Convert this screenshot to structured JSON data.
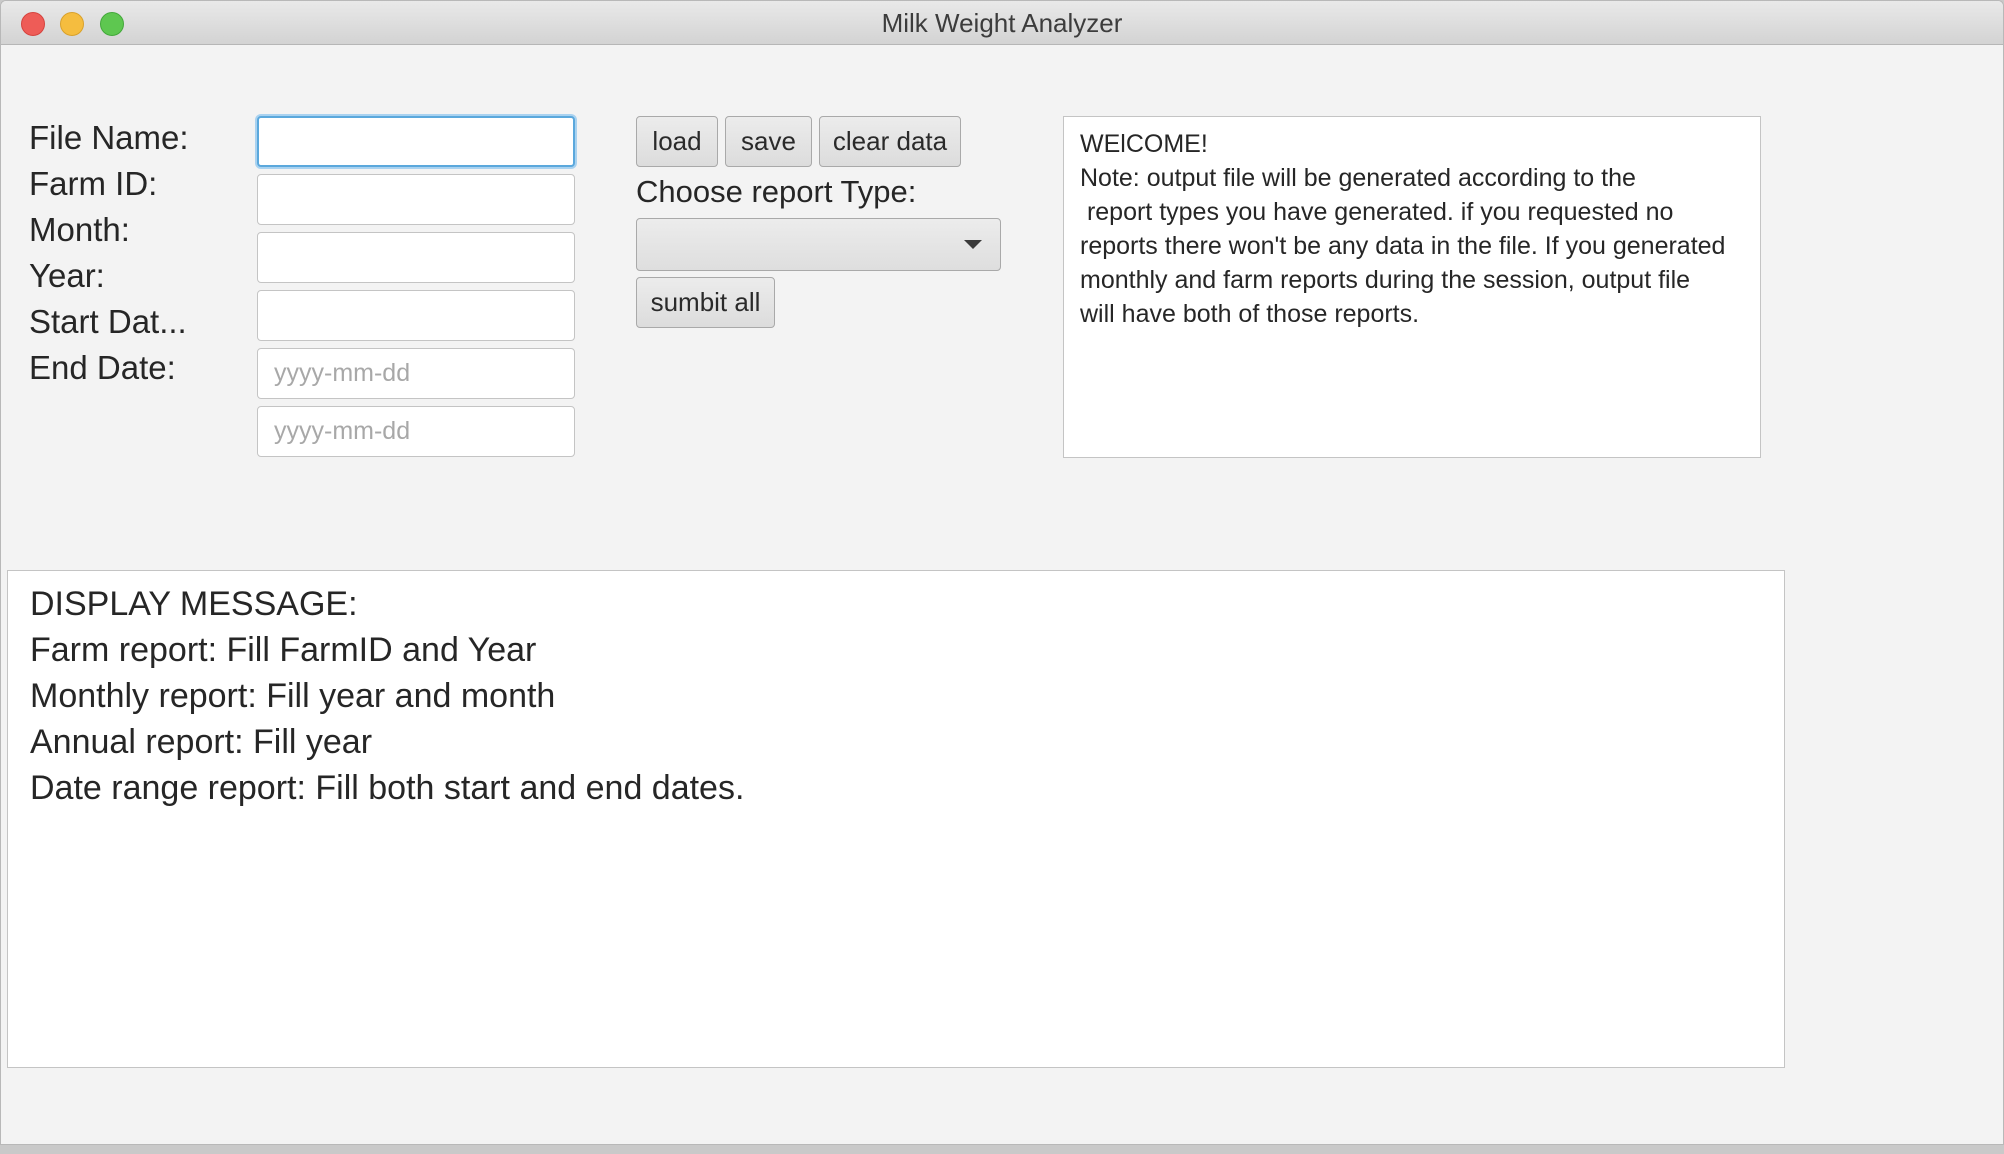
{
  "window": {
    "title": "Milk Weight Analyzer"
  },
  "form": {
    "labels": {
      "file_name": "File Name:",
      "farm_id": "Farm ID:",
      "month": "Month:",
      "year": "Year:",
      "start_date": "Start Dat...",
      "end_date": "End Date:"
    },
    "fields": {
      "file_name": {
        "value": "",
        "placeholder": ""
      },
      "farm_id": {
        "value": "",
        "placeholder": ""
      },
      "month": {
        "value": "",
        "placeholder": ""
      },
      "year": {
        "value": "",
        "placeholder": ""
      },
      "start_date": {
        "value": "",
        "placeholder": "yyyy-mm-dd"
      },
      "end_date": {
        "value": "",
        "placeholder": "yyyy-mm-dd"
      }
    }
  },
  "actions": {
    "load": "load",
    "save": "save",
    "clear": "clear data",
    "choose_report_label": "Choose report Type:",
    "report_type_selected": "",
    "submit": "sumbit all"
  },
  "welcome": {
    "lines": [
      "WElCOME!",
      "Note: output file will be generated according to the",
      " report types you have generated. if you requested no",
      "reports there won't be any data in the file. If you generated",
      "monthly and farm reports during the session, output file",
      "will have both of those reports."
    ]
  },
  "display": {
    "lines": [
      "DISPLAY MESSAGE:",
      "Farm report: Fill FarmID and Year",
      "Monthly report: Fill year and month",
      "Annual report: Fill year",
      "Date range report: Fill both start and end dates."
    ]
  }
}
